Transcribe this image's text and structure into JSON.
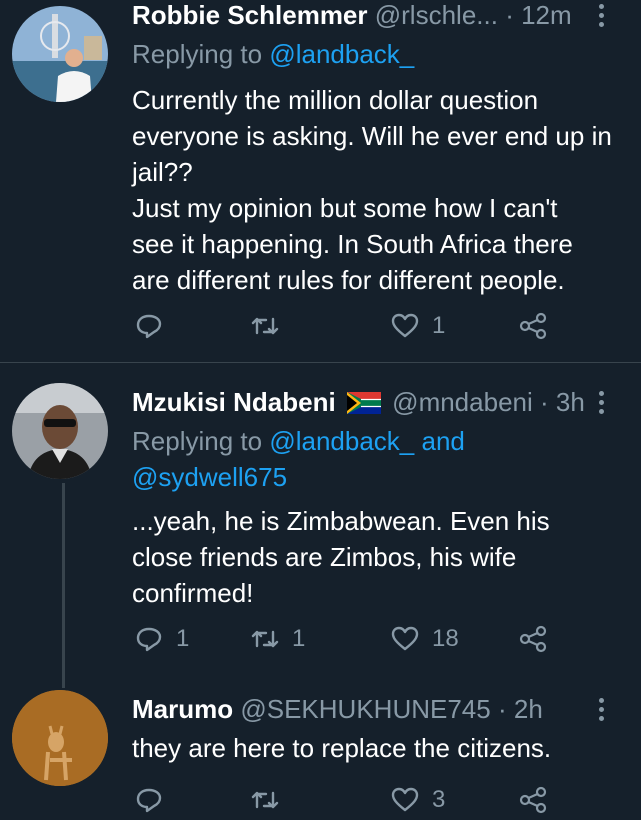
{
  "tweets": [
    {
      "name": "Robbie Schlemmer",
      "handle": "@rlschle...",
      "separator": "·",
      "time": "12m",
      "replying_prefix": "Replying to",
      "replying_to": [
        "@landback_"
      ],
      "text_lines": [
        "Currently the million dollar question",
        "everyone is asking. Will he ever end up in",
        "jail??",
        "Just my opinion but some how I can't",
        "see it happening. In South Africa there",
        "are different rules for different people."
      ],
      "counts": {
        "reply": "",
        "retweet": "",
        "like": "1"
      }
    },
    {
      "name": "Mzukisi Ndabeni",
      "flag_icon": "south-africa-flag",
      "handle": "@mndabeni",
      "separator": "·",
      "time": "3h",
      "replying_prefix": "Replying to",
      "replying_to": [
        "@landback_",
        "@sydwell675"
      ],
      "replying_and": "and",
      "text_lines": [
        "...yeah, he is Zimbabwean. Even his",
        "close friends are Zimbos, his wife",
        "confirmed!"
      ],
      "counts": {
        "reply": "1",
        "retweet": "1",
        "like": "18"
      }
    },
    {
      "name": "Marumo",
      "handle": "@SEKHUKHUNE745",
      "separator": "·",
      "time": "2h",
      "text_lines": [
        "they  are here to replace the citizens."
      ],
      "counts": {
        "reply": "",
        "retweet": "",
        "like": "3"
      }
    }
  ],
  "colors": {
    "background": "#15202b",
    "text": "#ffffff",
    "secondary": "#8899a6",
    "link": "#1da1f2",
    "divider": "#38444d"
  }
}
